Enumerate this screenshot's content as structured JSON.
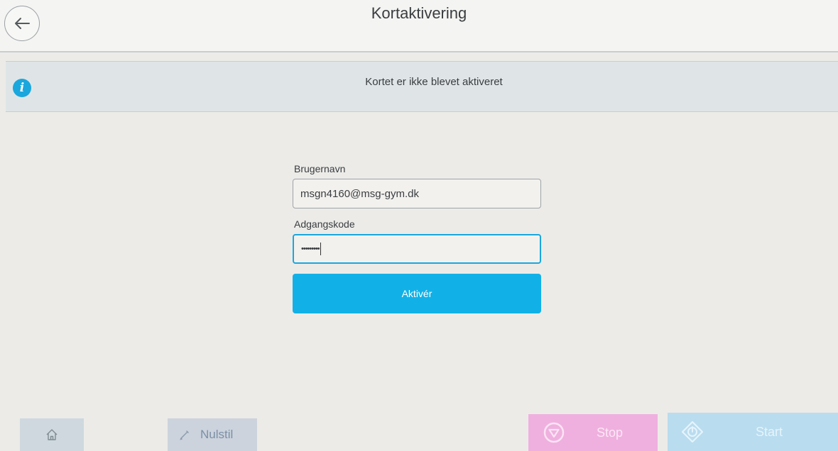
{
  "header": {
    "title": "Kortaktivering"
  },
  "banner": {
    "message": "Kortet er ikke blevet aktiveret"
  },
  "form": {
    "username_label": "Brugernavn",
    "username_value": "msgn4160@msg-gym.dk",
    "password_label": "Adgangskode",
    "password_value": "•••••••••",
    "submit_label": "Aktivér"
  },
  "footer": {
    "reset_label": "Nulstil",
    "stop_label": "Stop",
    "start_label": "Start"
  },
  "colors": {
    "accent": "#11b1e8",
    "info_icon": "#1aa7dd",
    "stop": "#efb0df",
    "start": "#b9dcef"
  }
}
